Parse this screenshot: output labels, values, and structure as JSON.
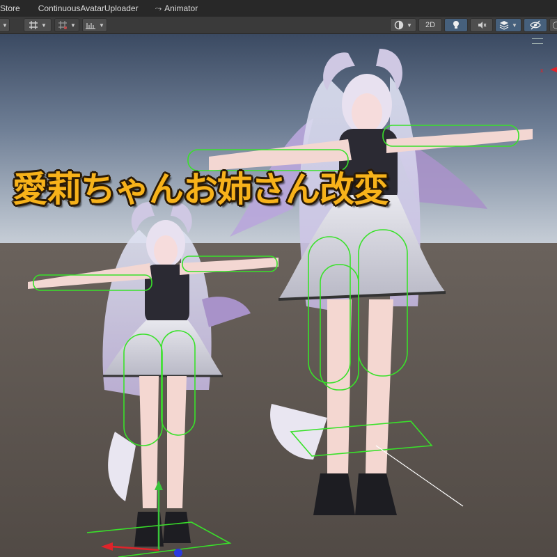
{
  "tabs": [
    {
      "label": "Store"
    },
    {
      "label": "ContinuousAvatarUploader"
    },
    {
      "label": "Animator",
      "icon": "animator-icon"
    }
  ],
  "toolbar": {
    "mode_2d": "2D",
    "items": [
      "draw-mode",
      "2d-toggle",
      "lighting-toggle",
      "audio-toggle",
      "effects-dropdown",
      "visibility-toggle"
    ],
    "accent": "#46607c"
  },
  "overlay": {
    "title": "愛莉ちゃんお姉さん改変",
    "title_color": "#f7b21a"
  },
  "scene": {
    "sky_top": "#3d4d66",
    "sky_horizon": "#b3bdc8",
    "ground": "#5a524c",
    "collider_color": "#39e12a",
    "axis_x_color": "#e0232a",
    "axis_y_color": "#39c43a",
    "axis_z_color": "#2a3ae0"
  }
}
